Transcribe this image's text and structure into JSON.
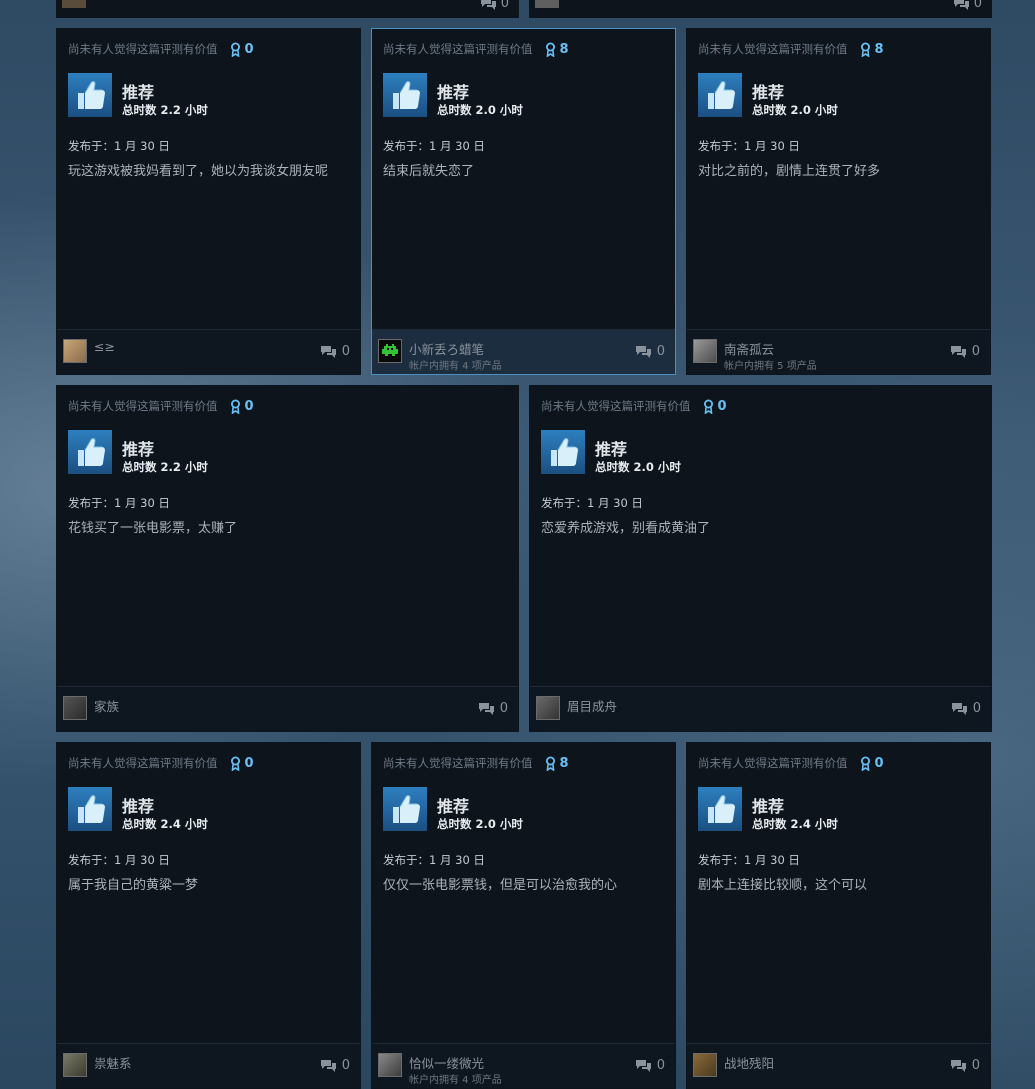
{
  "reviews": [
    {
      "helpful_text": "尚未有人觉得这篇评测有价值",
      "award_count": "0",
      "recommendation": "推荐",
      "hours": "总时数 2.2 小时",
      "posted": "发布于：1 月 30 日",
      "text": "玩这游戏被我妈看到了，她以为我谈女朋友呢",
      "author": "≤≥",
      "owned": "",
      "comment_count": "0"
    },
    {
      "helpful_text": "尚未有人觉得这篇评测有价值",
      "award_count": "8",
      "recommendation": "推荐",
      "hours": "总时数 2.0 小时",
      "posted": "发布于：1 月 30 日",
      "text": "结束后就失恋了",
      "author": "小新丢ろ蜡笔",
      "owned": "帐户内拥有 4 项产品",
      "comment_count": "0"
    },
    {
      "helpful_text": "尚未有人觉得这篇评测有价值",
      "award_count": "8",
      "recommendation": "推荐",
      "hours": "总时数 2.0 小时",
      "posted": "发布于：1 月 30 日",
      "text": "对比之前的，剧情上连贯了好多",
      "author": "南斋孤云",
      "owned": "帐户内拥有 5 项产品",
      "comment_count": "0"
    },
    {
      "helpful_text": "尚未有人觉得这篇评测有价值",
      "award_count": "0",
      "recommendation": "推荐",
      "hours": "总时数 2.2 小时",
      "posted": "发布于：1 月 30 日",
      "text": "花钱买了一张电影票，太赚了",
      "author": "家族",
      "owned": "",
      "comment_count": "0"
    },
    {
      "helpful_text": "尚未有人觉得这篇评测有价值",
      "award_count": "0",
      "recommendation": "推荐",
      "hours": "总时数 2.0 小时",
      "posted": "发布于：1 月 30 日",
      "text": "恋爱养成游戏，别看成黄油了",
      "author": "眉目成舟",
      "owned": "",
      "comment_count": "0"
    },
    {
      "helpful_text": "尚未有人觉得这篇评测有价值",
      "award_count": "0",
      "recommendation": "推荐",
      "hours": "总时数 2.4 小时",
      "posted": "发布于：1 月 30 日",
      "text": "属于我自己的黄粱一梦",
      "author": "祟魅系",
      "owned": "",
      "comment_count": "0"
    },
    {
      "helpful_text": "尚未有人觉得这篇评测有价值",
      "award_count": "8",
      "recommendation": "推荐",
      "hours": "总时数 2.0 小时",
      "posted": "发布于：1 月 30 日",
      "text": "仅仅一张电影票钱，但是可以治愈我的心",
      "author": "恰似一缕微光",
      "owned": "帐户内拥有 4 项产品",
      "comment_count": "0"
    },
    {
      "helpful_text": "尚未有人觉得这篇评测有价值",
      "award_count": "0",
      "recommendation": "推荐",
      "hours": "总时数 2.4 小时",
      "posted": "发布于：1 月 30 日",
      "text": "剧本上连接比较顺，这个可以",
      "author": "战地残阳",
      "owned": "",
      "comment_count": "0"
    }
  ],
  "top_partial": {
    "left_comment_count": "0",
    "right_comment_count": "0"
  },
  "colors": {
    "accent": "#66c0f4",
    "card_bg": "#0d141c",
    "thumb": "#2d7fbf",
    "active_border": "#4f8fbf"
  }
}
